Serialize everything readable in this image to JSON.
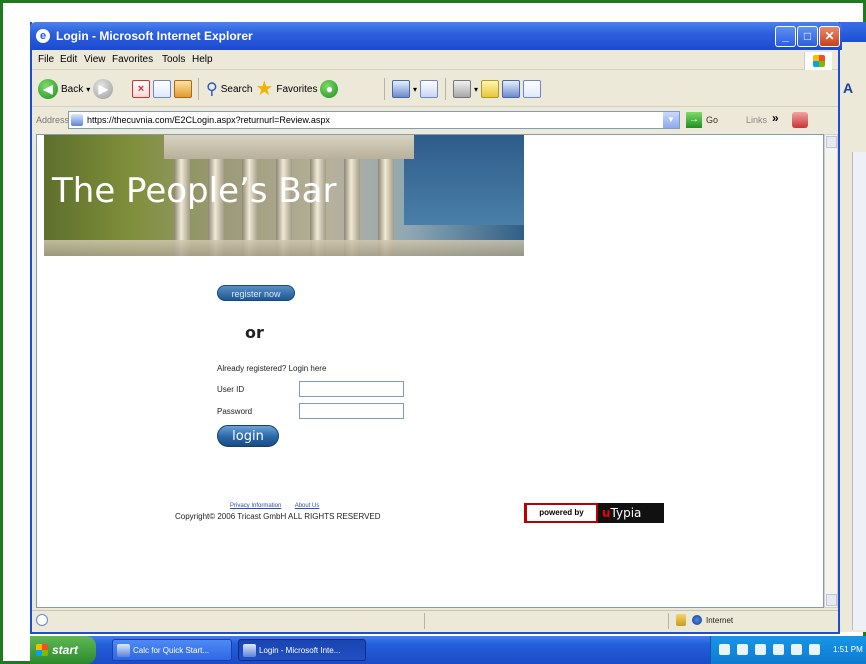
{
  "window": {
    "title": "Login - Microsoft Internet Explorer",
    "controls": {
      "minimize": "_",
      "maximize": "□",
      "close": "✕"
    }
  },
  "menubar": {
    "items": [
      "File",
      "Edit",
      "View",
      "Favorites",
      "Tools",
      "Help"
    ]
  },
  "toolbar": {
    "back_label": "Back",
    "search_label": "Search",
    "favorites_label": "Favorites",
    "icons": [
      "back-icon",
      "forward-icon",
      "stop-icon",
      "refresh-icon",
      "home-icon",
      "search-icon",
      "favorites-star-icon",
      "media-icon",
      "history-icon",
      "mail-icon",
      "print-icon",
      "edit-icon",
      "discuss-icon",
      "research-icon",
      "messenger-icon"
    ]
  },
  "addressbar": {
    "label": "Address",
    "url": "https://thecuvnia.com/E2CLogin.aspx?returnurl=Review.aspx",
    "go_label": "Go",
    "links_label": "Links",
    "links_chevron": "»"
  },
  "page": {
    "banner_title": "The People’s Bar",
    "register_label": "register now",
    "or_label": "or",
    "already_registered": "Already registered? Login here",
    "userid_label": "User ID",
    "userid_value": "",
    "password_label": "Password",
    "password_value": "",
    "login_label": "login",
    "footer_links": [
      "Privacy Information",
      "About Us"
    ],
    "copyright": "Copyright© 2006  Tricast GmbH  ALL RIGHTS RESERVED",
    "powered_by": "powered by",
    "brand_prefix": "u",
    "brand_rest": "Typia"
  },
  "statusbar": {
    "zone": "Internet"
  },
  "taskbar": {
    "start_label": "start",
    "items": [
      "Calc for Quick Start...",
      "Login - Microsoft Inte..."
    ],
    "clock": "1:51 PM"
  },
  "colors": {
    "frame_green": "#1f7a1f",
    "xp_blue": "#1c4fcf",
    "button_blue": "#2a66a6",
    "brand_red": "#e00000"
  }
}
